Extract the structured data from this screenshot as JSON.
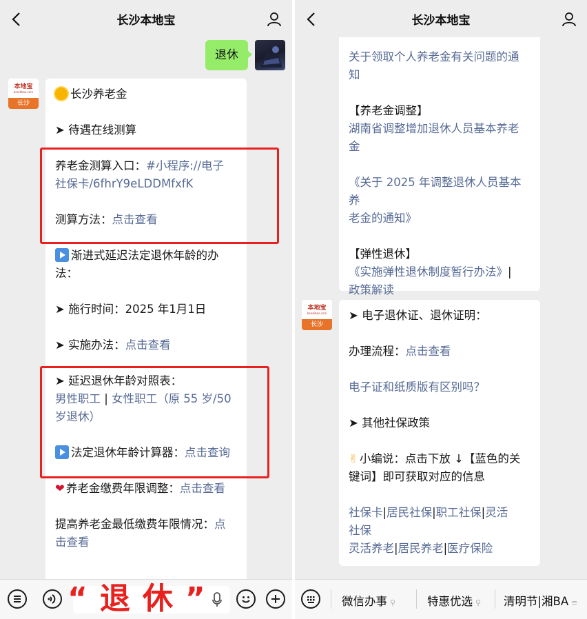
{
  "nav": {
    "title": "长沙本地宝"
  },
  "avatar": {
    "brand": "本地宝",
    "sub": "bendibao.com",
    "city": "长沙"
  },
  "left": {
    "user_message": "退休",
    "lines": {
      "l1": "长沙养老金",
      "l2": "➤ 待遇在线测算",
      "l3a": "养老金测算入口：",
      "l3b": "#小程序://电子",
      "l4": "社保卡/6fhrY9eLDDMfxfK",
      "l5a": "测算方法：",
      "l5b": "点击查看",
      "l6": "渐进式延迟法定退休年龄的办",
      "l7": "法：",
      "l8": "➤ 施行时间：2025 年1月1日",
      "l9a": "➤ 实施办法：",
      "l9b": "点击查看",
      "l10": "➤ 延迟退休年龄对照表：",
      "l11a": "男性职工",
      "l11b": "女性职工（原 55 岁/50",
      "l12": "岁退休）",
      "l13a": "法定退休年龄计算器：",
      "l13b": "点击查询",
      "l14a": "养老金缴费年限调整：",
      "l14b": "点击查看",
      "l15a": "提高养老金最低缴费年限情况：",
      "l15b": "点",
      "l16": "击查看"
    },
    "overlay": "“退休”"
  },
  "right": {
    "b1": {
      "l1": "关于领取个人养老金有关问题的通",
      "l2": "知",
      "l3": "【养老金调整】",
      "l4": "湖南省调整增加退休人员基本养老",
      "l5": "金",
      "l6": "《关于 2025 年调整退休人员基本养",
      "l7": "老金的通知》",
      "l8": "【弹性退休】",
      "l9a": "《实施弹性退休制度暂行办法》",
      "l9b": "|",
      "l10": "政策解读"
    },
    "b2": {
      "l1": "➤ 电子退休证、退休证明：",
      "l2a": "办理流程：",
      "l2b": "点击查看",
      "l3": "电子证和纸质版有区别吗？",
      "l4": "➤ 其他社保政策",
      "l5": "小编说：点击下放 ↓【蓝色的关",
      "l6": "键词】即可获取对应的信息",
      "k1": "社保卡",
      "k2": "居民社保",
      "k3": "职工社保",
      "k4": "灵活",
      "k5": "社保",
      "k6": "灵活养老",
      "k7": "居民养老",
      "k8": "医疗保险",
      "bar": "|"
    },
    "menu": [
      "微信办事",
      "特惠优选",
      "清明节|湘BA"
    ]
  },
  "colors": {
    "link": "#576b95",
    "highlight": "#e8211f",
    "bubble_self": "#95ec69",
    "chat_bg": "#ededed"
  }
}
